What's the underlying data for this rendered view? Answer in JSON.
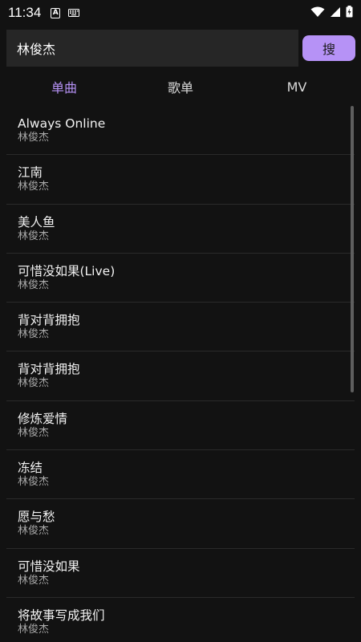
{
  "status_bar": {
    "time": "11:34",
    "notification_icons": [
      "a-box-icon",
      "keyboard-icon"
    ],
    "system_icons": [
      "wifi-icon",
      "signal-icon",
      "battery-charging-icon"
    ],
    "a_letter": "A"
  },
  "search": {
    "value": "林俊杰",
    "button_label": "搜"
  },
  "tabs": [
    {
      "label": "单曲",
      "active": true
    },
    {
      "label": "歌单",
      "active": false
    },
    {
      "label": "MV",
      "active": false
    }
  ],
  "songs": [
    {
      "title": "Always Online",
      "artist": "林俊杰"
    },
    {
      "title": "江南",
      "artist": "林俊杰"
    },
    {
      "title": "美人鱼",
      "artist": "林俊杰"
    },
    {
      "title": "可惜没如果(Live)",
      "artist": "林俊杰"
    },
    {
      "title": "背对背拥抱",
      "artist": "林俊杰"
    },
    {
      "title": "背对背拥抱",
      "artist": "林俊杰"
    },
    {
      "title": "修炼爱情",
      "artist": "林俊杰"
    },
    {
      "title": "冻结",
      "artist": "林俊杰"
    },
    {
      "title": "愿与愁",
      "artist": "林俊杰"
    },
    {
      "title": "可惜没如果",
      "artist": "林俊杰"
    },
    {
      "title": "将故事写成我们",
      "artist": "林俊杰"
    }
  ],
  "colors": {
    "background": "#121212",
    "accent": "#b692f6",
    "input_background": "#262626"
  }
}
